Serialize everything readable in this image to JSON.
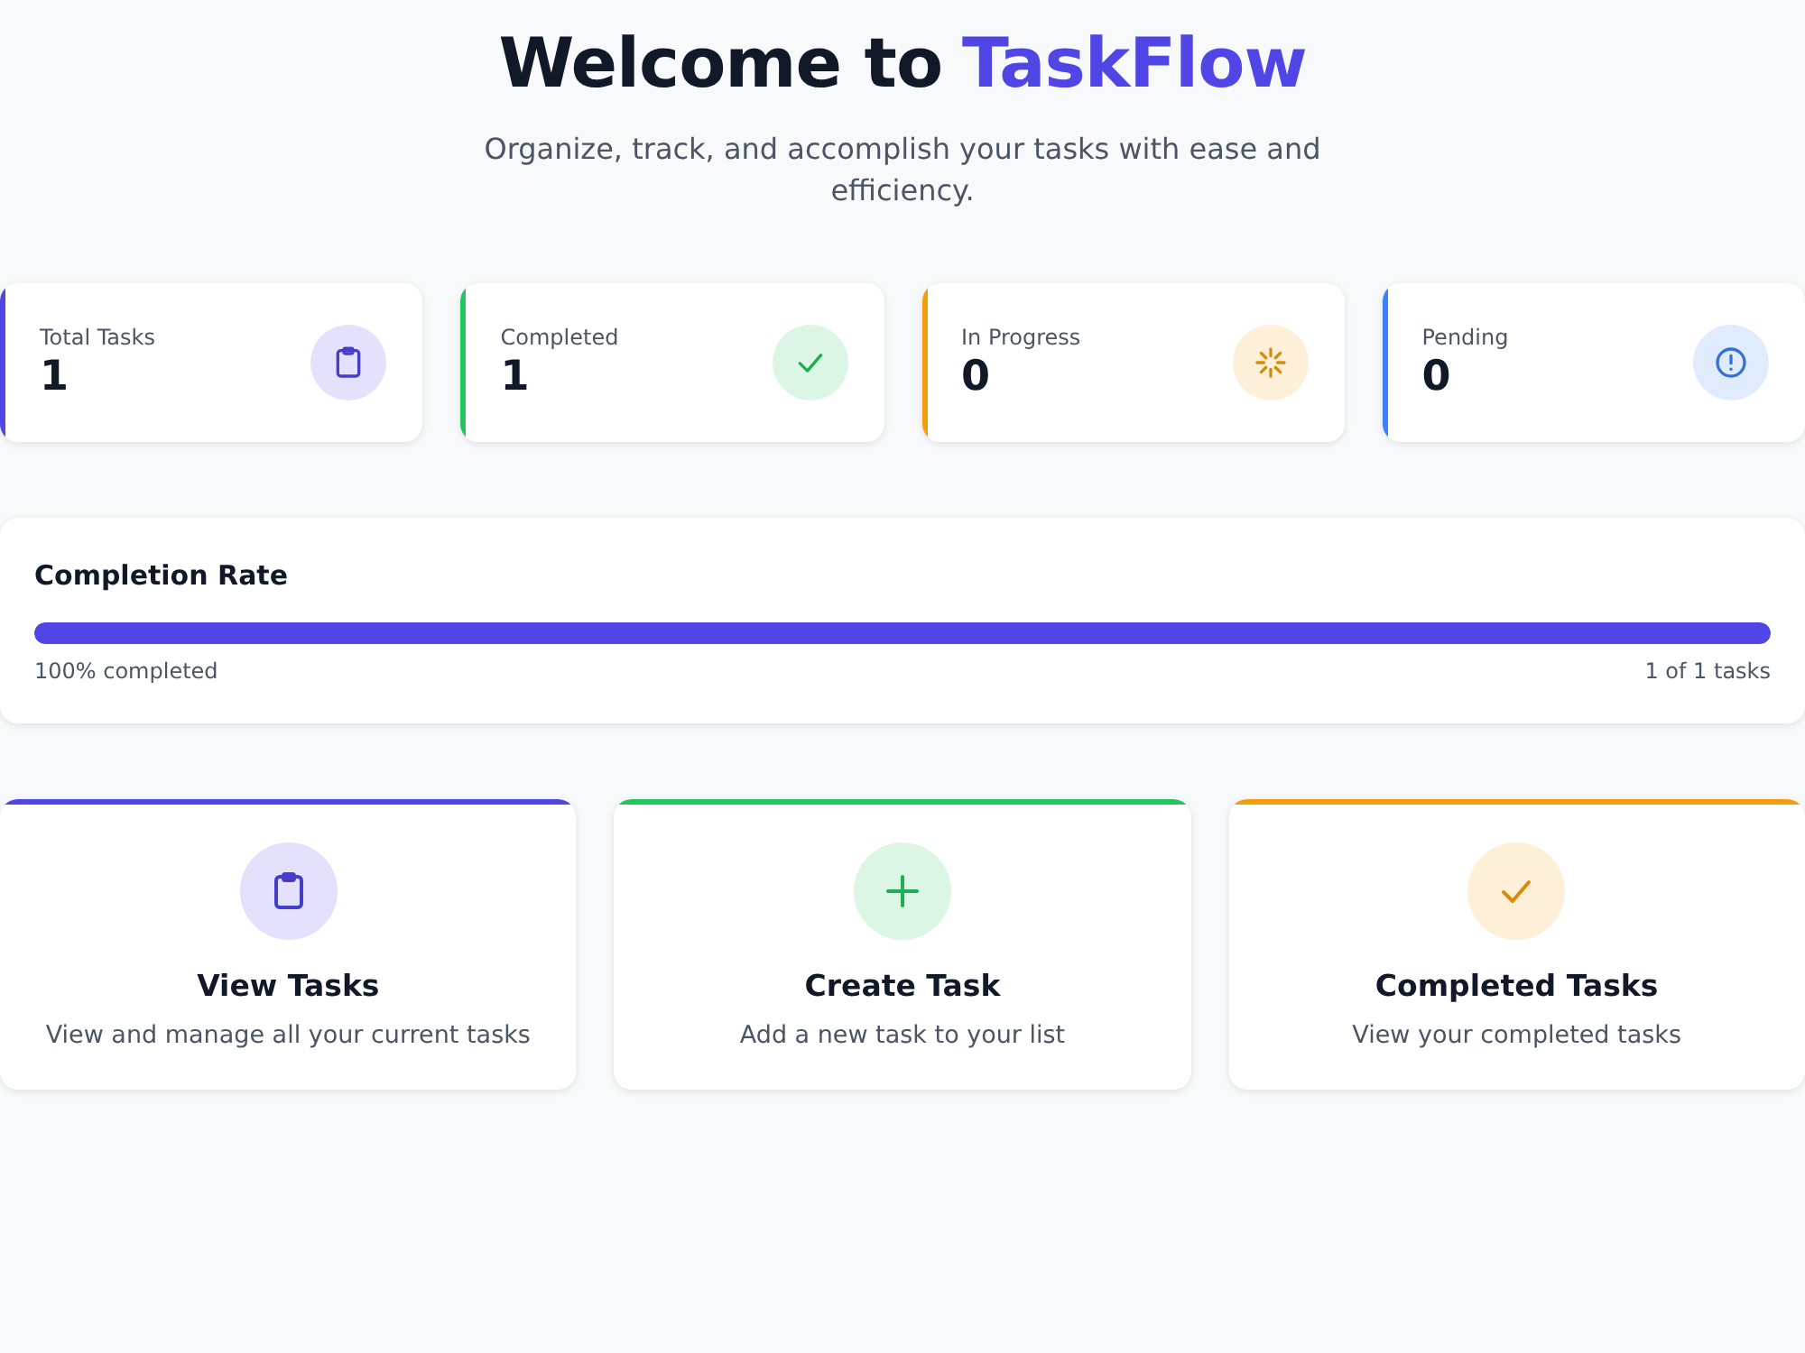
{
  "header": {
    "title": "Welcome to",
    "brand": "TaskFlow",
    "subtitle": "Organize, track, and accomplish your tasks with ease and efficiency."
  },
  "stats": [
    {
      "label": "Total Tasks",
      "value": "1",
      "color": "#4f46e5",
      "kind": "clipboard"
    },
    {
      "label": "Completed",
      "value": "1",
      "color": "#22c55e",
      "kind": "check"
    },
    {
      "label": "In Progress",
      "value": "0",
      "color": "#f59e0b",
      "kind": "spinner"
    },
    {
      "label": "Pending",
      "value": "0",
      "color": "#3b82f6",
      "kind": "alert"
    }
  ],
  "completion": {
    "title": "Completion Rate",
    "level": 1,
    "percent_label": "100% completed",
    "count_label": "1 of 1 tasks"
  },
  "actions": [
    {
      "title": "View Tasks",
      "description": "View and manage all your current tasks",
      "color": "#4f46e5",
      "kind": "clipboard"
    },
    {
      "title": "Create Task",
      "description": "Add a new task to your list",
      "color": "#22c55e",
      "kind": "plus"
    },
    {
      "title": "Completed Tasks",
      "description": "View your completed tasks",
      "color": "#f59e0b",
      "kind": "check"
    }
  ]
}
